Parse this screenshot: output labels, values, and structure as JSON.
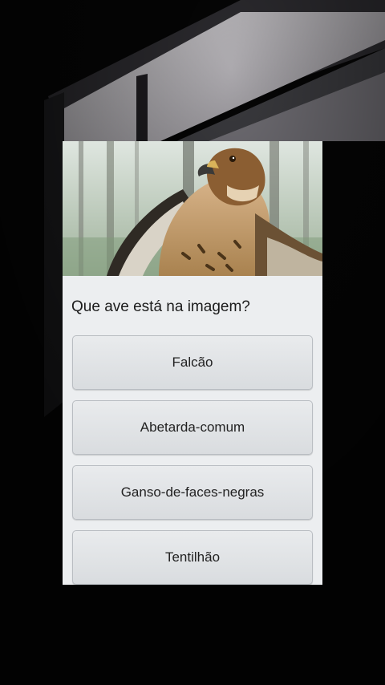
{
  "quiz": {
    "question": "Que ave está na imagem?",
    "options": [
      {
        "label": "Falcão"
      },
      {
        "label": "Abetarda-comum"
      },
      {
        "label": "Ganso-de-faces-negras"
      },
      {
        "label": "Tentilhão"
      }
    ]
  },
  "colors": {
    "card_background": "#eceef0",
    "button_border": "#b9bdc2",
    "text": "#1c1c1c"
  }
}
